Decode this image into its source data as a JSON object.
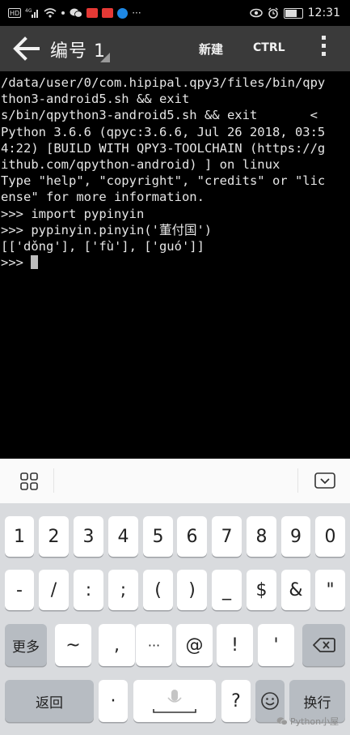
{
  "status_bar": {
    "left_icons": [
      "hd-icon",
      "4g-signal-icon",
      "wifi-icon",
      "dot-icon",
      "wechat-icon",
      "app-red-icon",
      "app-red2-icon",
      "app-blue-icon",
      "more-icon"
    ],
    "hd_label": "HD",
    "more_label": "···",
    "time": "12:31"
  },
  "action_bar": {
    "title": "编号 1",
    "new_label": "新建",
    "ctrl_label": "CTRL"
  },
  "terminal": {
    "lines": [
      "/data/user/0/com.hipipal.qpy3/files/bin/qpy",
      "thon3-android5.sh && exit",
      "s/bin/qpython3-android5.sh && exit       <",
      "Python 3.6.6 (qpyc:3.6.6, Jul 26 2018, 03:5",
      "4:22) [BUILD WITH QPY3-TOOLCHAIN (https://g",
      "ithub.com/qpython-android) ] on linux",
      "Type \"help\", \"copyright\", \"credits\" or \"lic",
      "ense\" for more information.",
      ">>> import pypinyin",
      ">>> pypinyin.pinyin('董付国')",
      "[['dǒng'], ['fù'], ['guó']]"
    ],
    "prompt": ">>> "
  },
  "keyboard": {
    "row1": [
      "1",
      "2",
      "3",
      "4",
      "5",
      "6",
      "7",
      "8",
      "9",
      "0"
    ],
    "row2": [
      "-",
      "/",
      ":",
      ";",
      "(",
      ")",
      "_",
      "$",
      "&",
      "\""
    ],
    "row3": [
      "更多",
      "~",
      ",",
      "···",
      "@",
      "!",
      "'"
    ],
    "row4": {
      "back_label": "返回",
      "dot_label": "·",
      "question_label": "?",
      "enter_label": "换行"
    }
  },
  "watermark": "Python小屋",
  "colors": {
    "terminal_bg": "#000000",
    "terminal_fg": "#e6e6e6",
    "actionbar_bg": "#3a3a3a",
    "keyboard_bg": "#d9dbde"
  }
}
